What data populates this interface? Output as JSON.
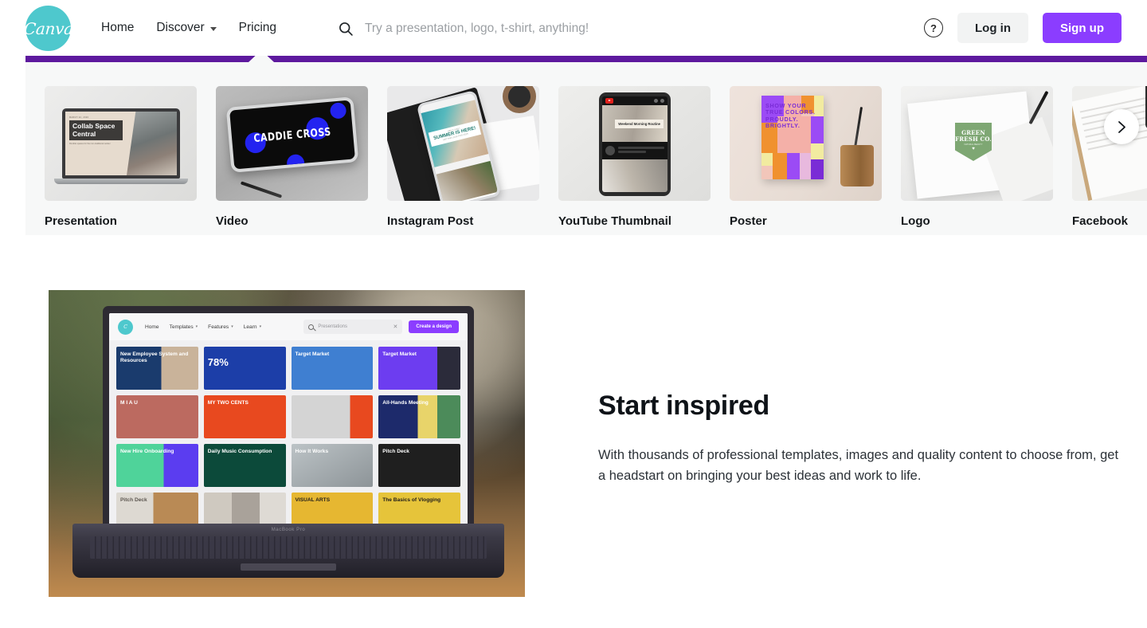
{
  "header": {
    "logo_text": "Canva",
    "logo_icon": "canva-logo-icon",
    "nav": [
      {
        "label": "Home",
        "has_dropdown": false
      },
      {
        "label": "Discover",
        "has_dropdown": true
      },
      {
        "label": "Pricing",
        "has_dropdown": false
      }
    ],
    "search": {
      "icon": "search-icon",
      "placeholder": "Try a presentation, logo, t-shirt, anything!",
      "value": ""
    },
    "help_icon_label": "?",
    "login_label": "Log in",
    "signup_label": "Sign up",
    "accent_purple": "#8b3dff",
    "brand_teal": "#4ec8cd"
  },
  "carousel": {
    "bar_color": "#5d199e",
    "panel_bg": "#f7f8f8",
    "next_icon": "chevron-right-icon",
    "cards": [
      {
        "label": "Presentation",
        "art": "presentation",
        "art_text": {
          "kicker": "MARCH 22, 2020",
          "title": "Collab Space Central",
          "sub": "Flexible spaces for the non-traditional worker"
        }
      },
      {
        "label": "Video",
        "art": "video",
        "art_text": {
          "title": "CADDIE CROSS"
        }
      },
      {
        "label": "Instagram Post",
        "art": "instagram",
        "art_text": {
          "kicker": "HEY A / HEY!",
          "title": "SUMMER IS HERE!",
          "sub": "GET THE LOOK FOR LESS"
        }
      },
      {
        "label": "YouTube Thumbnail",
        "art": "youtube",
        "art_text": {
          "title": "Weekend Morning Routine"
        }
      },
      {
        "label": "Poster",
        "art": "poster",
        "art_text": {
          "title": "SHOW YOUR TRUE COLORS. PROUDLY. BRIGHTLY."
        }
      },
      {
        "label": "Logo",
        "art": "logo",
        "art_text": {
          "title": "GREEN FRESH CO.",
          "sub": "NATURAL BEAUTY"
        }
      },
      {
        "label": "Facebook",
        "art": "facebook",
        "art_text": {}
      }
    ]
  },
  "hero": {
    "title": "Start inspired",
    "body": "With thousands of professional templates, images and quality content to choose from, get a headstart on bringing your best ideas and work to life.",
    "screenshot": {
      "logo_icon": "canva-logo-icon",
      "nav": [
        {
          "label": "Home",
          "has_dropdown": false
        },
        {
          "label": "Templates",
          "has_dropdown": true
        },
        {
          "label": "Features",
          "has_dropdown": true
        },
        {
          "label": "Learn",
          "has_dropdown": true
        }
      ],
      "search_value": "Presentations",
      "search_icon": "search-icon",
      "clear_icon": "close-icon",
      "cta_label": "Create a design",
      "device_label": "MacBook Pro",
      "templates": [
        {
          "label": "New Employee System and Resources",
          "bg": "#1a3b6d",
          "style": "photo-right"
        },
        {
          "label": "78%",
          "bg": "#1c3ea8",
          "style": "big"
        },
        {
          "label": "Target Market",
          "bg": "#3f7fd1",
          "style": "illus"
        },
        {
          "label": "Target Market",
          "bg": "#6d3df0",
          "style": "split"
        },
        {
          "label": "M I A U",
          "bg": "#bc6a60",
          "style": "photo"
        },
        {
          "label": "MY TWO CENTS",
          "bg": "#e8491f",
          "style": "photo"
        },
        {
          "label": "",
          "bg": "#d4d4d4",
          "style": "bw"
        },
        {
          "label": "All-Hands Meeting",
          "bg": "#1d2a6b",
          "style": "grid"
        },
        {
          "label": "New Hire Onboarding",
          "bg": "#4fd39a",
          "style": "grid"
        },
        {
          "label": "Daily Music Consumption",
          "bg": "#0c4a3a",
          "style": "chart"
        },
        {
          "label": "How It Works",
          "bg": "#9aa09a",
          "style": "photo"
        },
        {
          "label": "Pitch Deck",
          "bg": "#1f1f1f",
          "style": "dark"
        },
        {
          "label": "Pitch Deck",
          "bg": "#ddd9d2",
          "style": "photo"
        },
        {
          "label": "",
          "bg": "#c9c5bd",
          "style": "photo"
        },
        {
          "label": "VISUAL ARTS",
          "bg": "#e6b731",
          "style": "yellow"
        },
        {
          "label": "The Basics of Vlogging",
          "bg": "#e6c43a",
          "style": "yellow"
        }
      ]
    }
  }
}
